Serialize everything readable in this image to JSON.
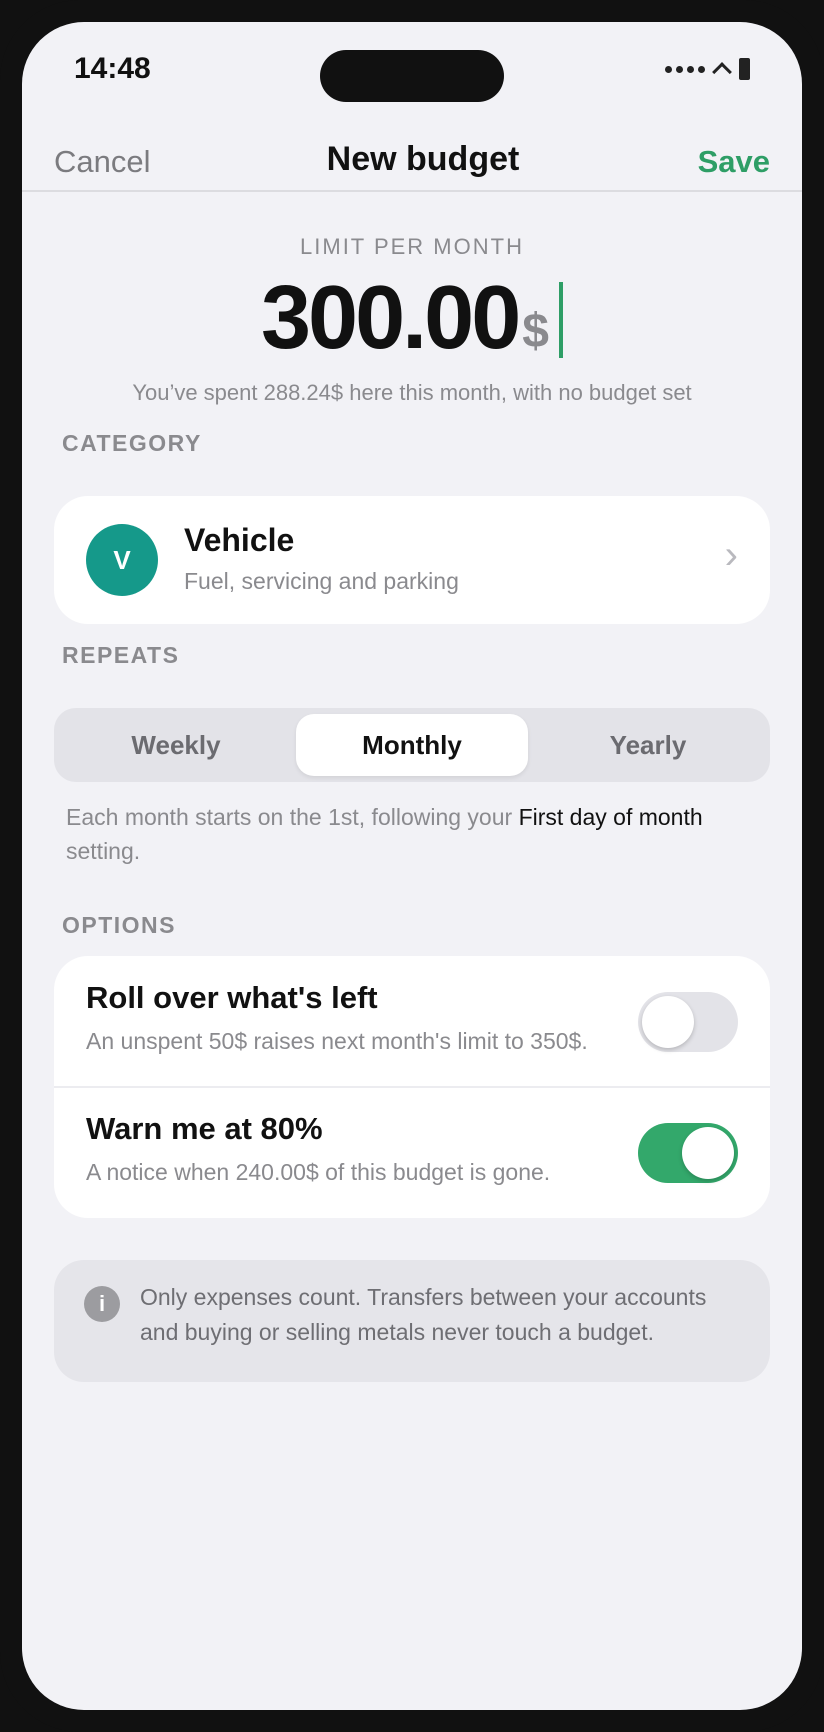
{
  "status_bar": {
    "time": "14:48"
  },
  "nav": {
    "cancel_label": "Cancel",
    "title": "New budget",
    "save_label": "Save"
  },
  "limit": {
    "label": "LIMIT PER MONTH",
    "amount": "300.00",
    "currency": "$",
    "note": "You’ve spent 288.24$ here this month, with no budget set"
  },
  "category": {
    "section_label": "CATEGORY",
    "initial": "V",
    "name": "Vehicle",
    "description": "Fuel, servicing and parking",
    "avatar_color": "#15998a"
  },
  "repeats": {
    "section_label": "REPEATS",
    "options": [
      "Weekly",
      "Monthly",
      "Yearly"
    ],
    "selected": "Monthly",
    "note_prefix": "Each month starts on the 1st, following your ",
    "note_link": "First day of month",
    "note_suffix": " setting."
  },
  "options": {
    "section_label": "OPTIONS",
    "items": [
      {
        "title": "Roll over what's left",
        "description": "An unspent 50$ raises next month's limit to 350$.",
        "enabled": false
      },
      {
        "title": "Warn me at 80%",
        "description": "A notice when 240.00$ of this budget is gone.",
        "enabled": true
      }
    ]
  },
  "info": {
    "icon": "info-icon",
    "text": "Only expenses count. Transfers between your accounts and buying or selling metals never touch a budget."
  },
  "colors": {
    "accent": "#2e9e66",
    "toggle_on": "#33a86b",
    "background": "#f2f2f6"
  }
}
